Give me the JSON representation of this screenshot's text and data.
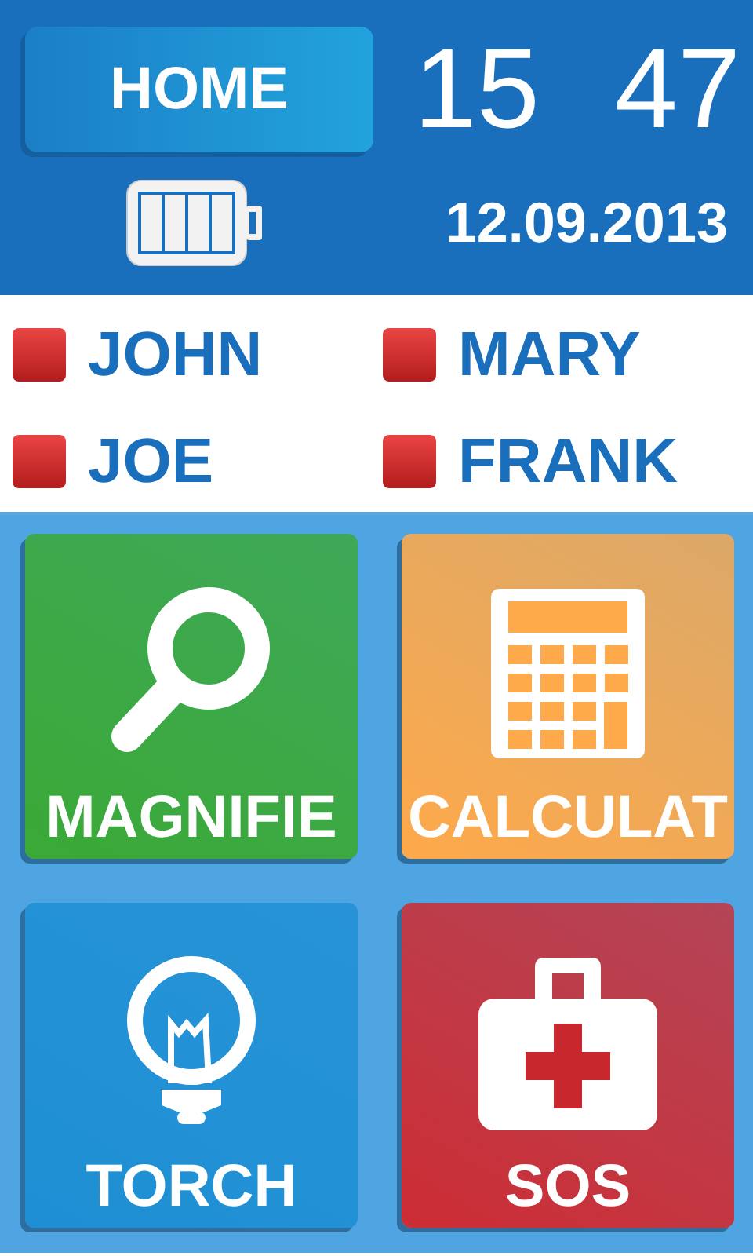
{
  "header": {
    "home_button": "HOME",
    "hours": "15",
    "minutes": "47",
    "date": "12.09.2013"
  },
  "contacts": [
    {
      "name": "JOHN"
    },
    {
      "name": "MARY"
    },
    {
      "name": "JOE"
    },
    {
      "name": "FRANK"
    }
  ],
  "tiles": [
    {
      "label": "MAGNIFIE",
      "kind": "magnifier",
      "color": "#3aa936"
    },
    {
      "label": "CALCULAT",
      "kind": "calculator",
      "color": "#fea94a"
    },
    {
      "label": "TORCH",
      "kind": "torch",
      "color": "#1e8fd4"
    },
    {
      "label": "SOS",
      "kind": "sos",
      "color": "#cd2d34"
    }
  ]
}
